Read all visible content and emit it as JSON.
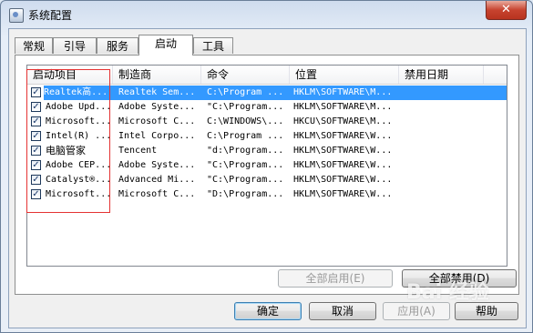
{
  "window": {
    "title": "系统配置",
    "close_label": "✕"
  },
  "tabs": [
    {
      "label": "常规"
    },
    {
      "label": "引导"
    },
    {
      "label": "服务"
    },
    {
      "label": "启动",
      "active": true
    },
    {
      "label": "工具"
    }
  ],
  "table": {
    "columns": [
      "启动项目",
      "制造商",
      "命令",
      "位置",
      "禁用日期"
    ],
    "rows": [
      {
        "checked": true,
        "item": "Realtek高...",
        "maker": "Realtek Sem...",
        "command": "C:\\Program ...",
        "location": "HKLM\\SOFTWARE\\M...",
        "date": "",
        "selected": true
      },
      {
        "checked": true,
        "item": "Adobe Upd...",
        "maker": "Adobe Syste...",
        "command": "\"C:\\Program...",
        "location": "HKLM\\SOFTWARE\\M...",
        "date": ""
      },
      {
        "checked": true,
        "item": "Microsoft...",
        "maker": "Microsoft C...",
        "command": "C:\\WINDOWS\\...",
        "location": "HKCU\\SOFTWARE\\M...",
        "date": ""
      },
      {
        "checked": true,
        "item": "Intel(R) ...",
        "maker": "Intel Corpo...",
        "command": "C:\\Program ...",
        "location": "HKLM\\SOFTWARE\\W...",
        "date": ""
      },
      {
        "checked": true,
        "item": "电脑管家",
        "maker": "Tencent",
        "command": "\"d:\\Program...",
        "location": "HKLM\\SOFTWARE\\W...",
        "date": ""
      },
      {
        "checked": true,
        "item": "Adobe CEP...",
        "maker": "Adobe Syste...",
        "command": "\"C:\\Program...",
        "location": "HKLM\\SOFTWARE\\W...",
        "date": ""
      },
      {
        "checked": true,
        "item": "Catalyst®...",
        "maker": "Advanced Mi...",
        "command": "\"C:\\Program...",
        "location": "HKLM\\SOFTWARE\\W...",
        "date": ""
      },
      {
        "checked": true,
        "item": "Microsoft...",
        "maker": "Microsoft C...",
        "command": "\"D:\\Program...",
        "location": "HKLM\\SOFTWARE\\W...",
        "date": ""
      }
    ]
  },
  "buttons": {
    "enable_all": "全部启用(E)",
    "disable_all": "全部禁用(D)",
    "ok": "确定",
    "cancel": "取消",
    "apply": "应用(A)",
    "help": "帮助"
  },
  "watermark": "Bai 经验",
  "icons": {
    "close": "close-icon",
    "app": "system-config-icon",
    "check": "checkmark-icon"
  },
  "colors": {
    "selection": "#3399ff",
    "annotation_box": "#e53333"
  }
}
